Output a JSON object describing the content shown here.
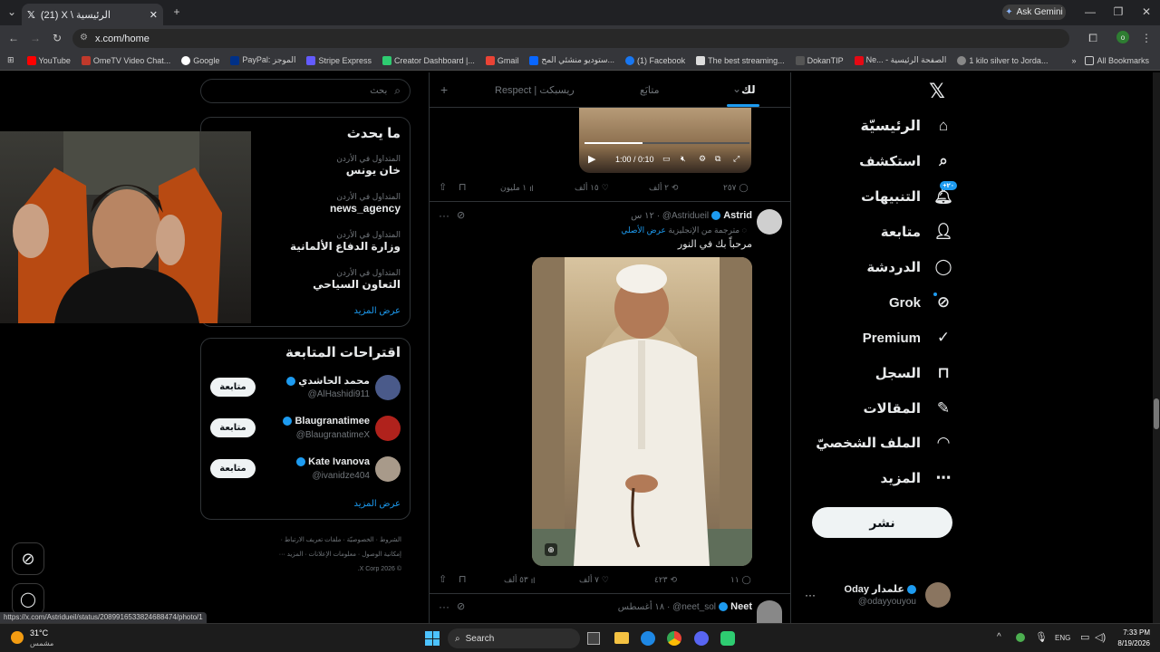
{
  "browser": {
    "tab_title": "(21) X \\ الرئيسية",
    "url": "x.com/home",
    "ask_gemini": "Ask Gemini",
    "bookmarks": [
      "YouTube",
      "OmeTV Video Chat...",
      "Google",
      "PayPal: الموجز",
      "Stripe Express",
      "Creator Dashboard |...",
      "Gmail",
      "ستوديو منشئي المح...",
      "(1) Facebook",
      "The best streaming...",
      "DokanTIP",
      "Ne... - الصفحة الرئيسية",
      "1 kilo silver to Jorda..."
    ],
    "all_bookmarks": "All Bookmarks",
    "status_url": "https://x.com/Astridueil/status/2089916533824688474/photo/1"
  },
  "sidebar": {
    "items": [
      "الرئيسيّة",
      "استكشف",
      "التنبيهات",
      "متابعة",
      "الدردشة",
      "Grok",
      "Premium",
      "السجل",
      "المقالات",
      "الملف الشخصيّ",
      "المزيد"
    ],
    "notif_badge": "+٢٠",
    "post_button": "نشر",
    "account_name": "Oday علمدار",
    "account_handle": "@odayyouyou"
  },
  "timeline": {
    "tabs": [
      "لك",
      "متابَع",
      "Respect | ريسبكت"
    ],
    "video_time": "1:00 / 0:10",
    "post1_stats": {
      "replies": "٢٥٧",
      "reposts": "٢ ألف",
      "likes": "١٥ ألف",
      "views": "١ مليون"
    },
    "post2": {
      "name": "Astrid",
      "handle": "@Astridueil",
      "time": "١٢ س",
      "translated_note": "مترجمة من الإنجليزية",
      "show_original": "عرض الأصلي",
      "text": "مرحباً بك في النور",
      "stats": {
        "replies": "١١",
        "reposts": "٤٢٣",
        "likes": "٧ ألف",
        "views": "٥٣ ألف"
      }
    },
    "post3": {
      "name": "Neet",
      "handle": "@neet_sol",
      "time": "١٨ أغسطس"
    }
  },
  "right": {
    "search_placeholder": "بحث",
    "trending_title": "ما يحدث",
    "trends": [
      {
        "meta": "المتداول في الأردن",
        "title": "خان يونس"
      },
      {
        "meta": "المتداول في الأردن",
        "title": "news_agency"
      },
      {
        "meta": "المتداول في الأردن",
        "title": "وزارة الدفاع الألمانية"
      },
      {
        "meta": "المتداول في الأردن",
        "title": "التعاون السياحي"
      }
    ],
    "show_more": "عرض المزيد",
    "follow_title": "اقتراحات المتابعة",
    "suggestions": [
      {
        "name": "محمد الحاشدي",
        "handle": "@AlHashidi911",
        "button": "متابعة"
      },
      {
        "name": "Blaugranatimee",
        "handle": "@BlaugranatimeX",
        "button": "متابعة"
      },
      {
        "name": "Kate Ivanova",
        "handle": "@ivanidze404",
        "button": "متابعة"
      }
    ],
    "footer1": "الشروط · الخصوصيّة · ملفات تعريف الارتباط ·",
    "footer2": "إمكانية الوصول · معلومات الإعلانات · المزيد ···",
    "footer3": "© X Corp 2026."
  },
  "taskbar": {
    "temp": "31°C",
    "weather": "مشمس",
    "search": "Search",
    "lang": "ENG",
    "time": "7:33 PM",
    "date": "8/19/2026"
  },
  "colors": {
    "accent": "#1d9bf0",
    "bg": "#000000",
    "chrome": "#35363a"
  }
}
